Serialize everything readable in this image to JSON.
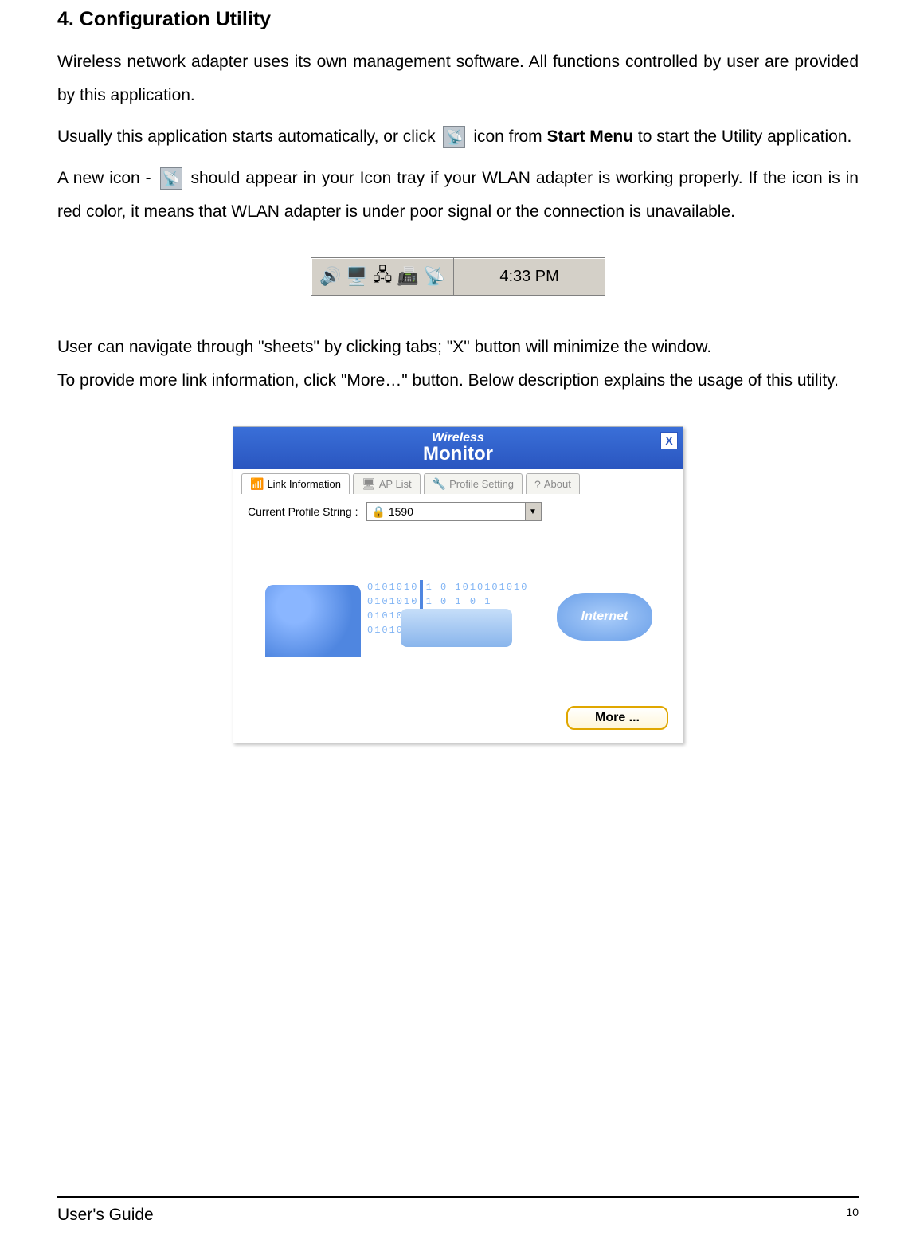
{
  "heading": "4. Configuration Utility",
  "p1": "Wireless network adapter uses its own management software. All functions controlled by user are provided by this application.",
  "p2a": "Usually this application starts automatically, or click ",
  "p2b": " icon from ",
  "p2_bold": "Start Menu",
  "p2c": " to start the Utility application.",
  "p3a": "A new icon - ",
  "p3b": " should appear in your Icon tray if your WLAN adapter is working properly. If the icon is in red color, it means that WLAN adapter is under poor signal or the connection is unavailable.",
  "tray": {
    "time": "4:33 PM"
  },
  "p4": "User can navigate through \"sheets\" by clicking tabs; \"X\" button will minimize the window.",
  "p5": "To provide more link information, click \"More…\" button. Below description explains the usage of this utility.",
  "monitor": {
    "title_small": "Wireless",
    "title_big": "Monitor",
    "close": "X",
    "tabs": {
      "link": "Link Information",
      "aplist": "AP List",
      "profile": "Profile Setting",
      "about": "About"
    },
    "profile_label": "Current Profile String :",
    "profile_value": "🔒 1590",
    "binary": "0101010 1 0 1010101010\n0101010 1 0 1 0 1\n01010101 0 1 0 1 0\n01010101010 1 0 1010",
    "internet": "Internet",
    "more": "More ..."
  },
  "footer": {
    "label": "User's Guide",
    "page": "10"
  }
}
